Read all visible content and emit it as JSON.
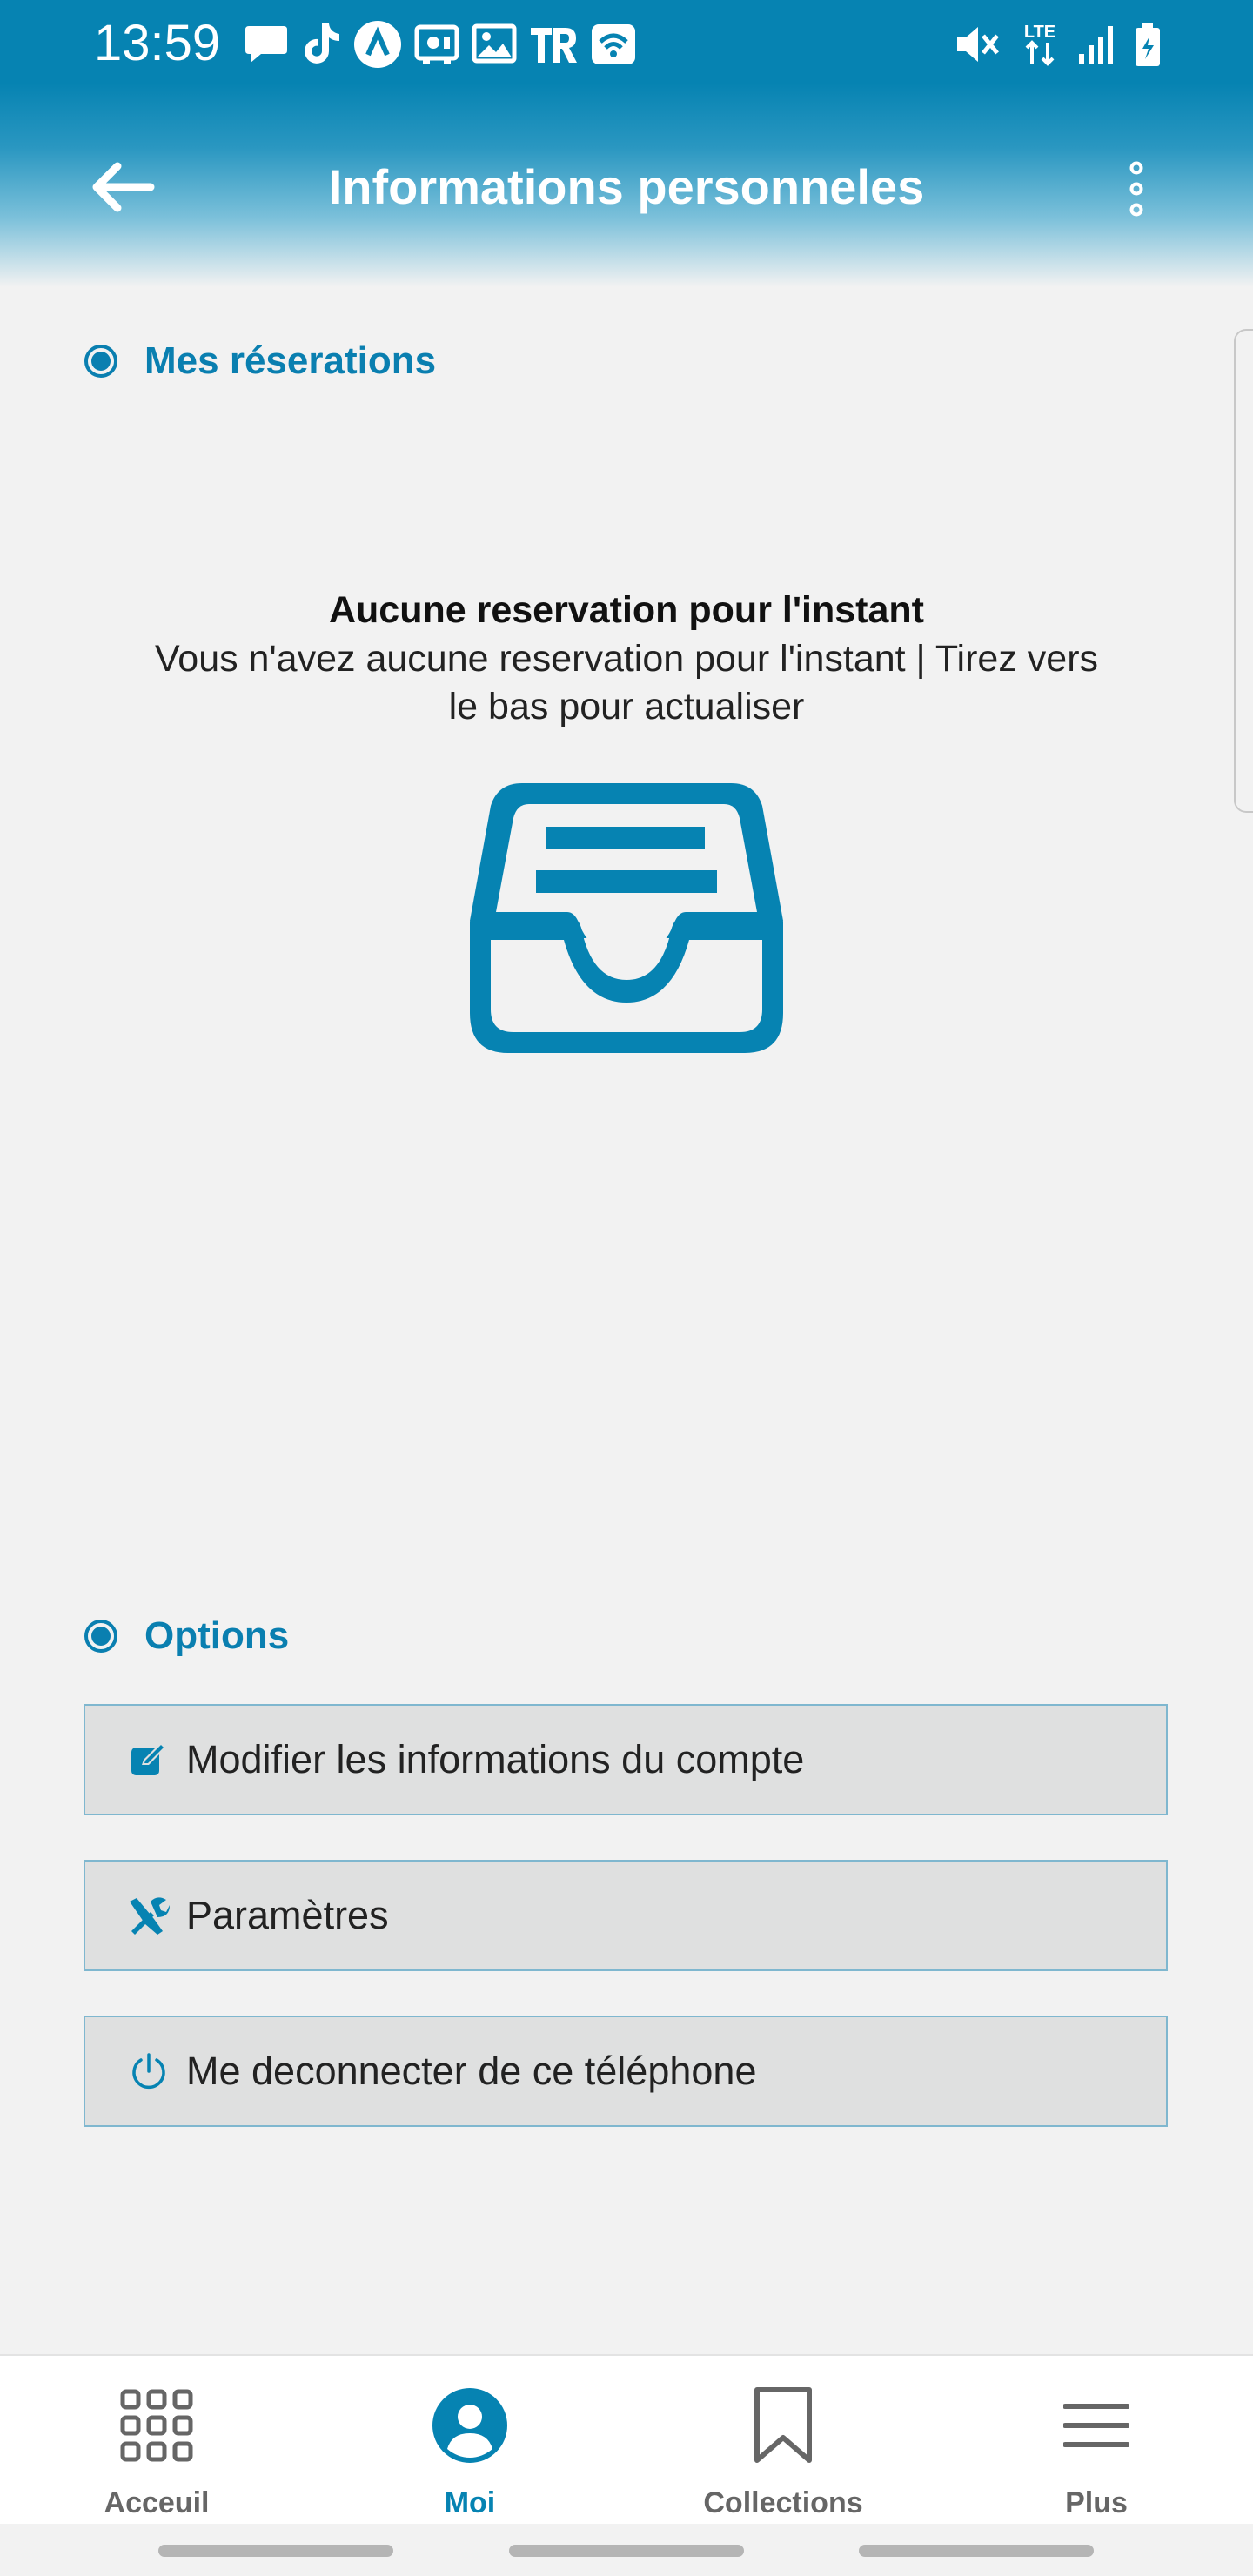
{
  "status_bar": {
    "time": "13:59",
    "network": "LTE",
    "notification_icons": [
      "chat-bubble-icon",
      "tiktok-icon",
      "arrow-a-icon",
      "vpn-icon",
      "image-icon",
      "tr-icon",
      "wifi-badge-icon"
    ],
    "system_icons": [
      "mute-icon",
      "lte-icon",
      "signal-icon",
      "battery-icon"
    ]
  },
  "header": {
    "title": "Informations personneles",
    "back_icon": "arrow-left-icon",
    "more_icon": "more-vertical-icon"
  },
  "reservations": {
    "heading": "Mes réserations",
    "empty_title": "Aucune reservation pour l'instant",
    "empty_message": "Vous n'avez aucune reservation pour l'instant | Tirez vers le bas pour actualiser",
    "empty_icon": "inbox-tray-icon"
  },
  "options": {
    "heading": "Options",
    "items": [
      {
        "label": "Modifier les informations du compte",
        "icon": "edit-icon"
      },
      {
        "label": "Paramètres",
        "icon": "tools-icon"
      },
      {
        "label": "Me deconnecter de ce téléphone",
        "icon": "power-icon"
      }
    ]
  },
  "bottom_nav": [
    {
      "label": "Acceuil",
      "icon": "grid-icon",
      "active": false
    },
    {
      "label": "Moi",
      "icon": "user-icon",
      "active": true
    },
    {
      "label": "Collections",
      "icon": "bookmark-icon",
      "active": false
    },
    {
      "label": "Plus",
      "icon": "menu-icon",
      "active": false
    }
  ],
  "colors": {
    "accent": "#0683b2",
    "background": "#f2f2f2",
    "button_bg": "#dfe0e0",
    "inactive_nav": "#666666"
  }
}
